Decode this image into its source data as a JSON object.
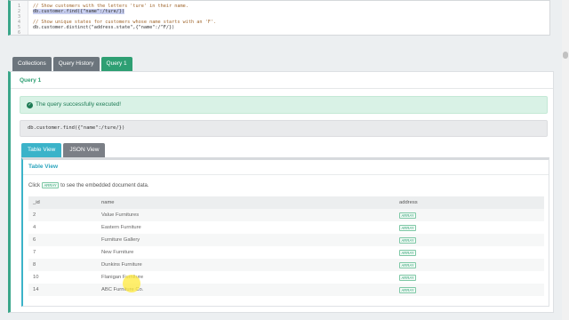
{
  "editor": {
    "line_numbers": [
      "1",
      "2",
      "3",
      "4",
      "5",
      "6"
    ],
    "lines": [
      {
        "text": "// Show customers with the letters 'ture' in their name.",
        "kind": "comment"
      },
      {
        "text": "db.customer.find({\"name\":/ture/})",
        "kind": "code-selected"
      },
      {
        "text": "",
        "kind": "blank"
      },
      {
        "text": "// Show unique states for customers whose name starts with an 'F'.",
        "kind": "comment"
      },
      {
        "text": "db.customer.distinct(\"address.state\",{\"name\":/^F/})",
        "kind": "code"
      },
      {
        "text": "",
        "kind": "blank"
      }
    ]
  },
  "tabs": [
    {
      "label": "Collections",
      "active": false
    },
    {
      "label": "Query History",
      "active": false
    },
    {
      "label": "Query 1",
      "active": true
    }
  ],
  "panel": {
    "title": "Query 1",
    "success_message": "The query successfully executed!",
    "query_text": "db.customer.find({\"name\":/ture/})"
  },
  "subtabs": [
    {
      "label": "Table View",
      "active": true
    },
    {
      "label": "JSON View",
      "active": false
    }
  ],
  "table_view": {
    "title": "Table View",
    "hint_prefix": "Click",
    "hint_badge": "ARRAY",
    "hint_suffix": "to see the embedded document data.",
    "columns": [
      "_id",
      "name",
      "address"
    ],
    "rows": [
      {
        "id": "2",
        "name": "Value Furnitures",
        "address": "ARRAY"
      },
      {
        "id": "4",
        "name": "Eastern Furniture",
        "address": "ARRAY"
      },
      {
        "id": "6",
        "name": "Furniture Gallery",
        "address": "ARRAY"
      },
      {
        "id": "7",
        "name": "New Furniture",
        "address": "ARRAY"
      },
      {
        "id": "8",
        "name": "Dunkins Furniture",
        "address": "ARRAY"
      },
      {
        "id": "10",
        "name": "Flanigan Furniture",
        "address": "ARRAY"
      },
      {
        "id": "14",
        "name": "ABC Furniture Co.",
        "address": "ARRAY"
      }
    ]
  },
  "colors": {
    "accent_green": "#2e9f73",
    "accent_teal": "#3bb3c9",
    "tab_gray": "#6c757d",
    "success_bg": "#d9f2e6"
  }
}
